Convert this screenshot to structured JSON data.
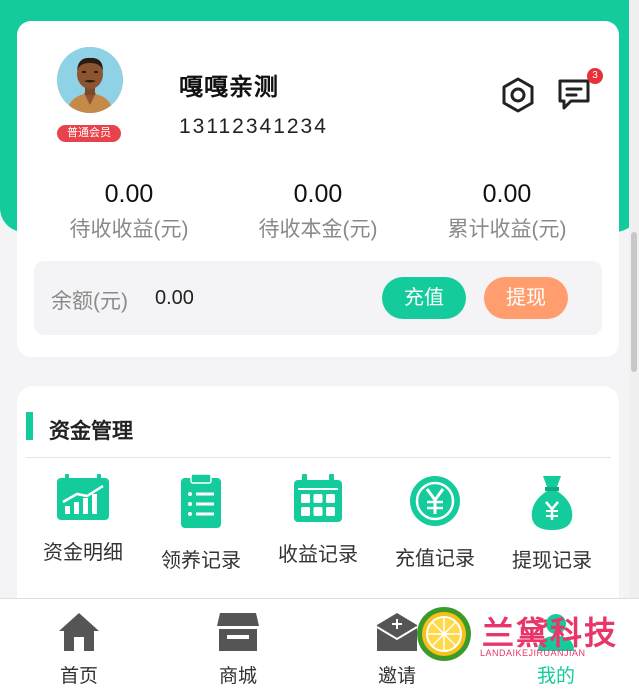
{
  "profile": {
    "username": "嘎嘎亲测",
    "phone": "13112341234",
    "member_level": "普通会员",
    "unread_messages": "3"
  },
  "stats": [
    {
      "value": "0.00",
      "label": "待收收益(元)"
    },
    {
      "value": "0.00",
      "label": "待收本金(元)"
    },
    {
      "value": "0.00",
      "label": "累计收益(元)"
    }
  ],
  "balance": {
    "label": "余额(元)",
    "value": "0.00",
    "recharge_label": "充值",
    "withdraw_label": "提现"
  },
  "funds": {
    "title": "资金管理",
    "items": [
      {
        "label": "资金明细",
        "icon": "chart-icon"
      },
      {
        "label": "领养记录",
        "icon": "clipboard-icon"
      },
      {
        "label": "收益记录",
        "icon": "calendar-icon"
      },
      {
        "label": "充值记录",
        "icon": "yen-coin-icon"
      },
      {
        "label": "提现记录",
        "icon": "money-bag-icon"
      }
    ]
  },
  "tabbar": {
    "items": [
      {
        "label": "首页",
        "icon": "home-icon"
      },
      {
        "label": "商城",
        "icon": "store-icon"
      },
      {
        "label": "邀请",
        "icon": "invite-icon"
      },
      {
        "label": "我的",
        "icon": "user-icon",
        "active": true
      }
    ]
  },
  "watermark": {
    "text": "兰黛科技",
    "subtext": "LANDAIKEJIRUANJIAN"
  },
  "colors": {
    "primary": "#14cc9b",
    "withdraw": "#ff9d6e",
    "badge": "#e8434a"
  }
}
